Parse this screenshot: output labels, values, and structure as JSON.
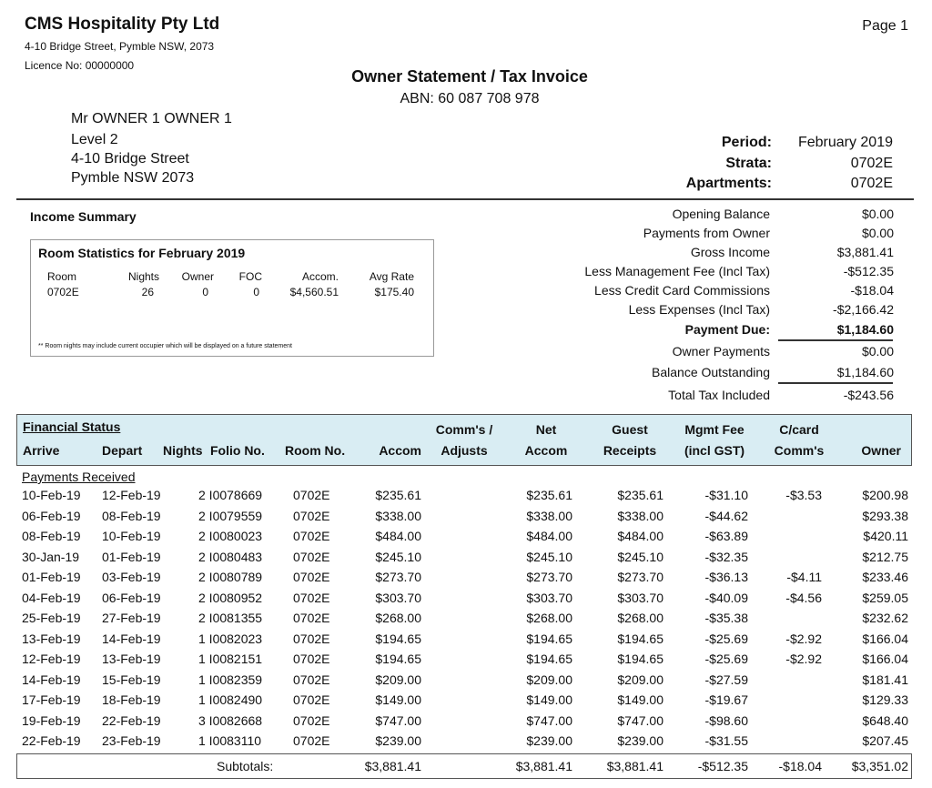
{
  "header": {
    "company": "CMS Hospitality Pty Ltd",
    "address": "4-10 Bridge Street, Pymble NSW, 2073",
    "licence": "Licence No: 00000000",
    "page": "Page 1",
    "title": "Owner Statement / Tax Invoice",
    "abn": "ABN: 60 087 708 978"
  },
  "recipient": {
    "name": "Mr  OWNER 1 OWNER 1",
    "line2": "Level 2",
    "line3": "4-10 Bridge Street",
    "line4": "Pymble NSW  2073"
  },
  "meta": {
    "period_label": "Period:",
    "period_value": "February  2019",
    "strata_label": "Strata:",
    "strata_value": "0702E",
    "apartments_label": "Apartments:",
    "apartments_value": "0702E"
  },
  "income_summary": {
    "title": "Income Summary",
    "rows": [
      {
        "label": "Opening Balance",
        "value": "$0.00"
      },
      {
        "label": "Payments from Owner",
        "value": "$0.00"
      },
      {
        "label": "Gross Income",
        "value": "$3,881.41"
      },
      {
        "label": "Less Management Fee (Incl Tax)",
        "value": "-$512.35"
      },
      {
        "label": "Less Credit Card Commissions",
        "value": "-$18.04"
      },
      {
        "label": "Less Expenses (Incl Tax)",
        "value": "-$2,166.42"
      },
      {
        "label": "Payment Due:",
        "value": "$1,184.60"
      },
      {
        "label": "Owner Payments",
        "value": "$0.00"
      },
      {
        "label": "Balance Outstanding",
        "value": "$1,184.60"
      },
      {
        "label": "Total Tax Included",
        "value": "-$243.56"
      }
    ]
  },
  "room_stats": {
    "title": "Room Statistics for February  2019",
    "headers": {
      "room": "Room",
      "nights": "Nights",
      "owner": "Owner",
      "foc": "FOC",
      "accom": "Accom.",
      "avg_rate": "Avg Rate"
    },
    "row": {
      "room": "0702E",
      "nights": "26",
      "owner": "0",
      "foc": "0",
      "accom": "$4,560.51",
      "avg_rate": "$175.40"
    },
    "note": "** Room nights may include current occupier which will be displayed on a future statement"
  },
  "financial_status": {
    "title": "Financial Status",
    "headers": {
      "arrive": "Arrive",
      "depart": "Depart",
      "nights": "Nights",
      "folio": "Folio No.",
      "room": "Room No.",
      "accom": "Accom",
      "comms_1": "Comm's /",
      "comms_2": "Adjusts",
      "net_1": "Net",
      "net_2": "Accom",
      "guest_1": "Guest",
      "guest_2": "Receipts",
      "mgmt_1": "Mgmt Fee",
      "mgmt_2": "(incl GST)",
      "ccard_1": "C/card",
      "ccard_2": "Comm's",
      "owner": "Owner"
    },
    "section": "Payments Received",
    "rows": [
      {
        "arrive": "10-Feb-19",
        "depart": "12-Feb-19",
        "nf": "2 I0078669",
        "room": "0702E",
        "accom": "$235.61",
        "net": "$235.61",
        "guest": "$235.61",
        "mgmt": "-$31.10",
        "ccard": "-$3.53",
        "owner": "$200.98"
      },
      {
        "arrive": "06-Feb-19",
        "depart": "08-Feb-19",
        "nf": "2 I0079559",
        "room": "0702E",
        "accom": "$338.00",
        "net": "$338.00",
        "guest": "$338.00",
        "mgmt": "-$44.62",
        "ccard": "",
        "owner": "$293.38"
      },
      {
        "arrive": "08-Feb-19",
        "depart": "10-Feb-19",
        "nf": "2 I0080023",
        "room": "0702E",
        "accom": "$484.00",
        "net": "$484.00",
        "guest": "$484.00",
        "mgmt": "-$63.89",
        "ccard": "",
        "owner": "$420.11"
      },
      {
        "arrive": "30-Jan-19",
        "depart": "01-Feb-19",
        "nf": "2 I0080483",
        "room": "0702E",
        "accom": "$245.10",
        "net": "$245.10",
        "guest": "$245.10",
        "mgmt": "-$32.35",
        "ccard": "",
        "owner": "$212.75"
      },
      {
        "arrive": "01-Feb-19",
        "depart": "03-Feb-19",
        "nf": "2 I0080789",
        "room": "0702E",
        "accom": "$273.70",
        "net": "$273.70",
        "guest": "$273.70",
        "mgmt": "-$36.13",
        "ccard": "-$4.11",
        "owner": "$233.46"
      },
      {
        "arrive": "04-Feb-19",
        "depart": "06-Feb-19",
        "nf": "2 I0080952",
        "room": "0702E",
        "accom": "$303.70",
        "net": "$303.70",
        "guest": "$303.70",
        "mgmt": "-$40.09",
        "ccard": "-$4.56",
        "owner": "$259.05"
      },
      {
        "arrive": "25-Feb-19",
        "depart": "27-Feb-19",
        "nf": "2 I0081355",
        "room": "0702E",
        "accom": "$268.00",
        "net": "$268.00",
        "guest": "$268.00",
        "mgmt": "-$35.38",
        "ccard": "",
        "owner": "$232.62"
      },
      {
        "arrive": "13-Feb-19",
        "depart": "14-Feb-19",
        "nf": "1 I0082023",
        "room": "0702E",
        "accom": "$194.65",
        "net": "$194.65",
        "guest": "$194.65",
        "mgmt": "-$25.69",
        "ccard": "-$2.92",
        "owner": "$166.04"
      },
      {
        "arrive": "12-Feb-19",
        "depart": "13-Feb-19",
        "nf": "1 I0082151",
        "room": "0702E",
        "accom": "$194.65",
        "net": "$194.65",
        "guest": "$194.65",
        "mgmt": "-$25.69",
        "ccard": "-$2.92",
        "owner": "$166.04"
      },
      {
        "arrive": "14-Feb-19",
        "depart": "15-Feb-19",
        "nf": "1 I0082359",
        "room": "0702E",
        "accom": "$209.00",
        "net": "$209.00",
        "guest": "$209.00",
        "mgmt": "-$27.59",
        "ccard": "",
        "owner": "$181.41"
      },
      {
        "arrive": "17-Feb-19",
        "depart": "18-Feb-19",
        "nf": "1 I0082490",
        "room": "0702E",
        "accom": "$149.00",
        "net": "$149.00",
        "guest": "$149.00",
        "mgmt": "-$19.67",
        "ccard": "",
        "owner": "$129.33"
      },
      {
        "arrive": "19-Feb-19",
        "depart": "22-Feb-19",
        "nf": "3 I0082668",
        "room": "0702E",
        "accom": "$747.00",
        "net": "$747.00",
        "guest": "$747.00",
        "mgmt": "-$98.60",
        "ccard": "",
        "owner": "$648.40"
      },
      {
        "arrive": "22-Feb-19",
        "depart": "23-Feb-19",
        "nf": "1 I0083110",
        "room": "0702E",
        "accom": "$239.00",
        "net": "$239.00",
        "guest": "$239.00",
        "mgmt": "-$31.55",
        "ccard": "",
        "owner": "$207.45"
      }
    ],
    "subtotals": {
      "label": "Subtotals:",
      "accom": "$3,881.41",
      "net": "$3,881.41",
      "guest": "$3,881.41",
      "mgmt": "-$512.35",
      "ccard": "-$18.04",
      "owner": "$3,351.02"
    }
  }
}
